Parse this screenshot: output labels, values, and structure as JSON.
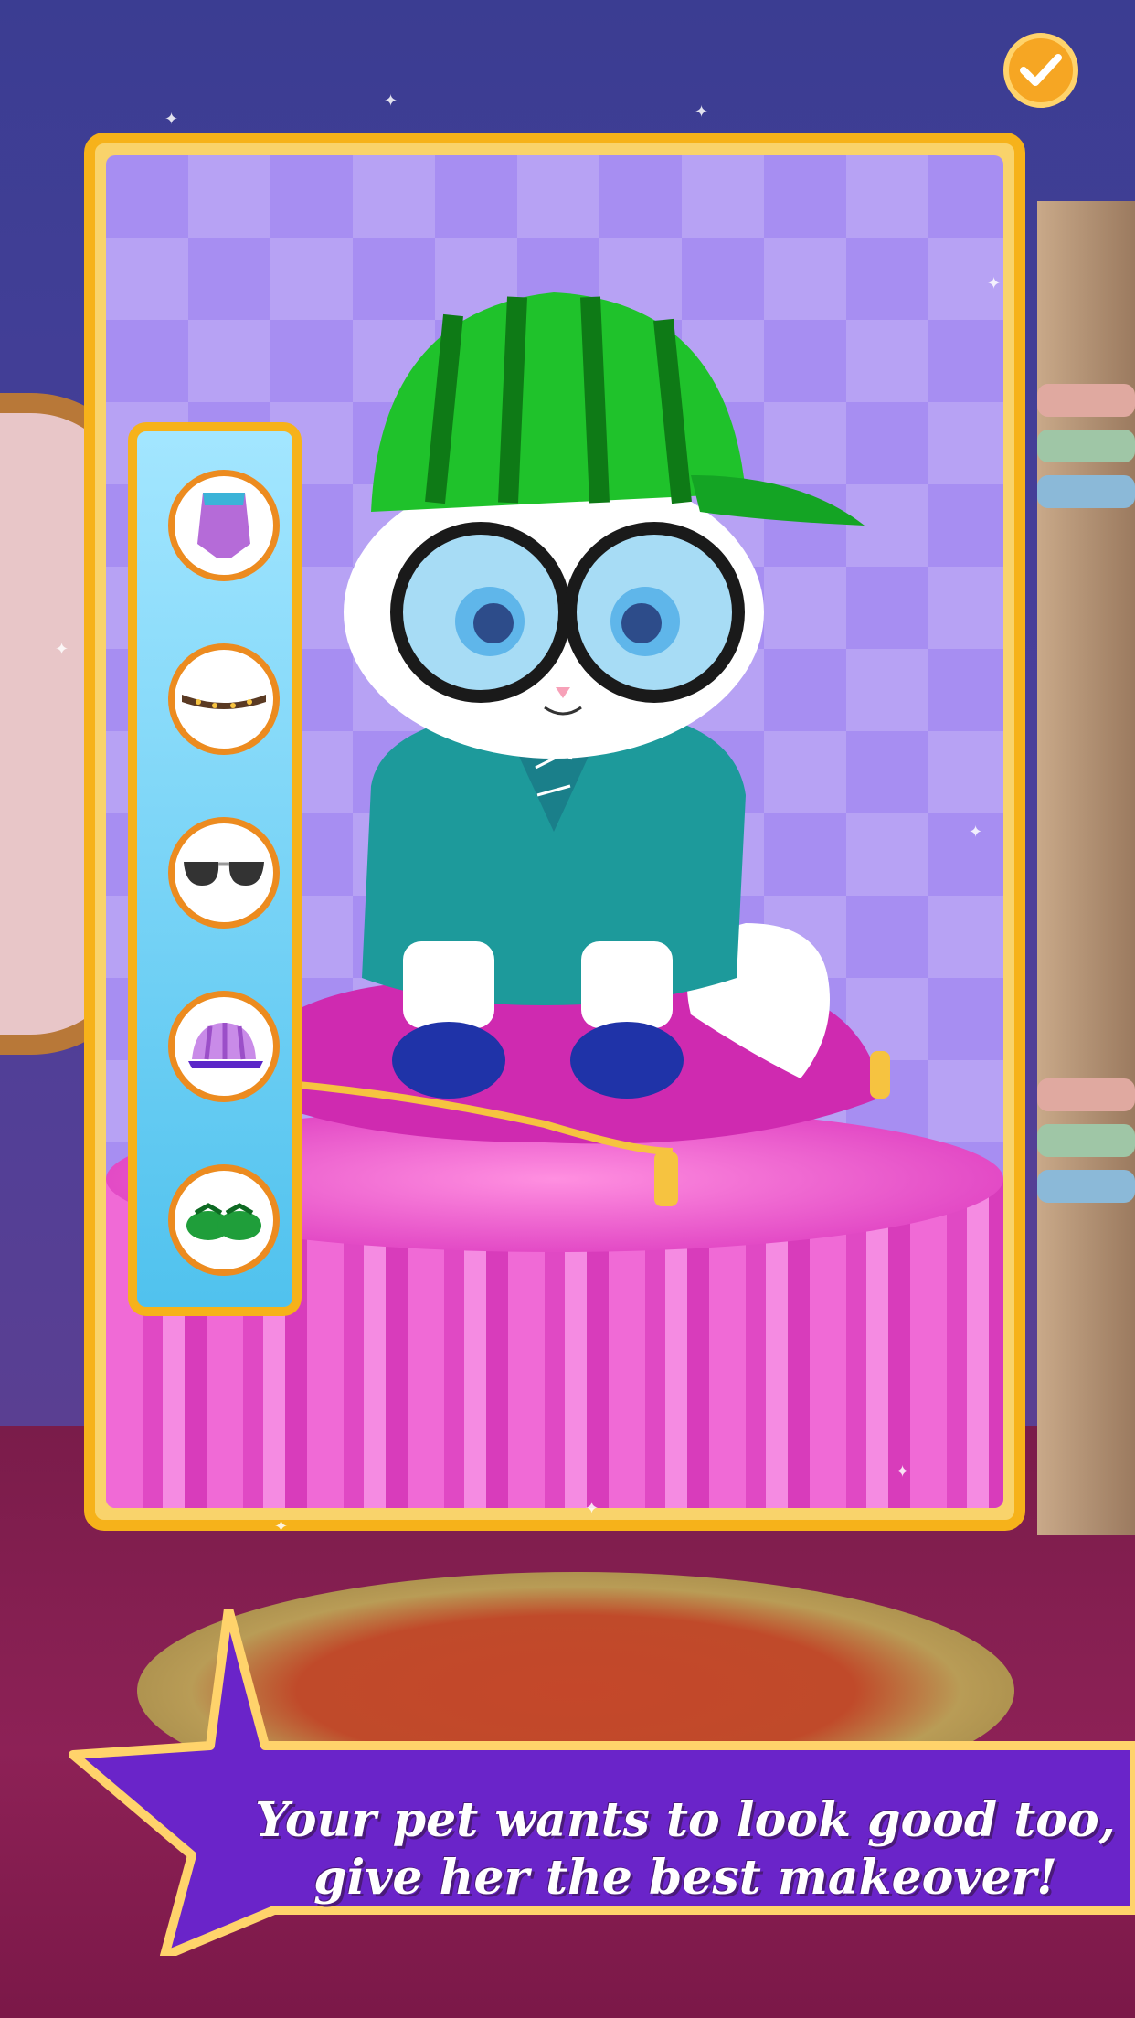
{
  "screen": {
    "title": "",
    "accent_color": "#f6b21a",
    "banner_color": "#6a24c9"
  },
  "top_bar": {
    "done_button": {
      "icon": "checkmark-icon",
      "color": "#f6a623"
    }
  },
  "wardrobe_sidebar": {
    "items": [
      {
        "category": "outfit",
        "icon": "shirt-icon"
      },
      {
        "category": "collar",
        "icon": "collar-icon"
      },
      {
        "category": "sunglasses",
        "icon": "sunglasses-icon"
      },
      {
        "category": "hat",
        "icon": "cap-icon"
      },
      {
        "category": "shoes",
        "icon": "shoes-icon"
      }
    ]
  },
  "pet": {
    "type": "white kitten",
    "outfit": {
      "hat": "green striped cap",
      "glasses": "round black glasses",
      "top": "teal laced robe",
      "shoes": "blue slippers"
    }
  },
  "caption": {
    "line1": "Your pet wants to look good too,",
    "line2": "give her the best makeover!"
  }
}
